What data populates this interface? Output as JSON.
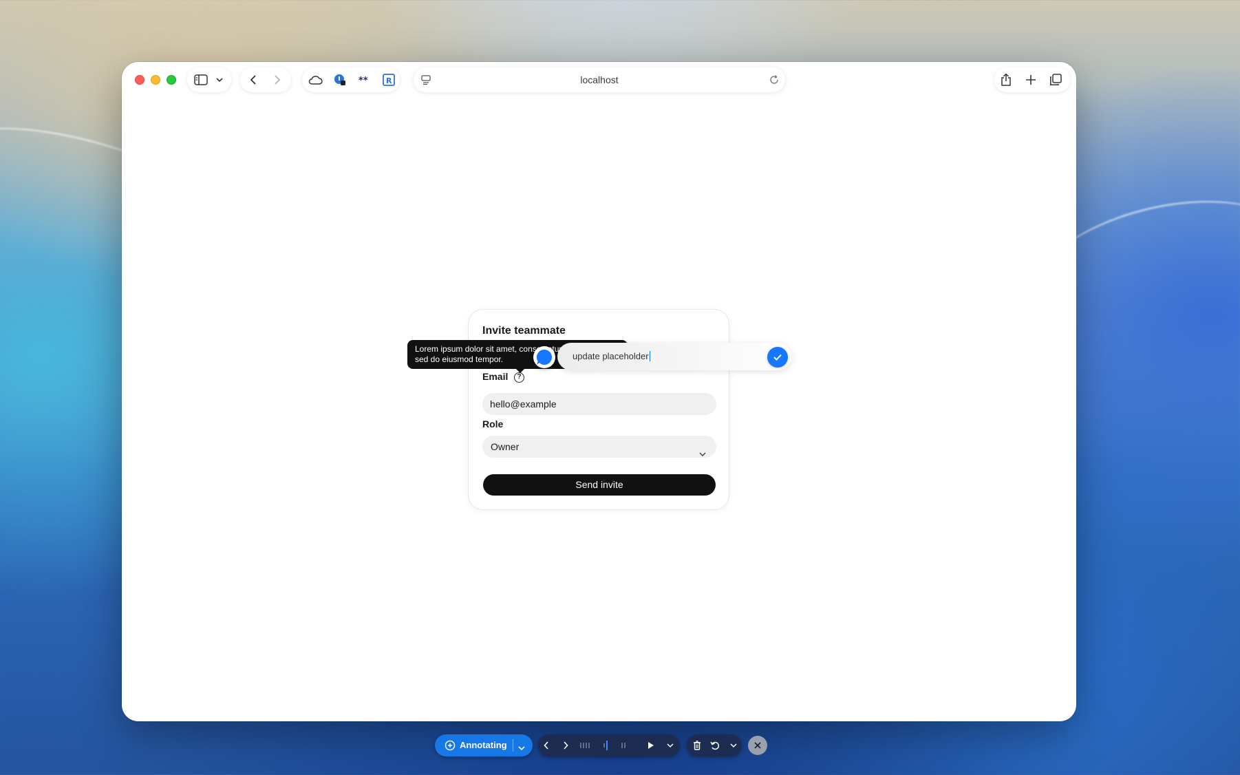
{
  "browser": {
    "url": "localhost"
  },
  "form": {
    "title": "Invite teammate",
    "email_label": "Email",
    "help_glyph": "?",
    "email_value": "hello@example",
    "role_label": "Role",
    "role_value": "Owner",
    "submit_label": "Send invite"
  },
  "tooltip": {
    "text": "Lorem ipsum dolor sit amet, consectetur adipiscing elit, sed do eiusmod tempor."
  },
  "annotation": {
    "input_value": "update placeholder"
  },
  "bottom_toolbar": {
    "mode_label": "Annotating"
  },
  "colors": {
    "accent": "#1677e6",
    "primary_button": "#111111"
  }
}
